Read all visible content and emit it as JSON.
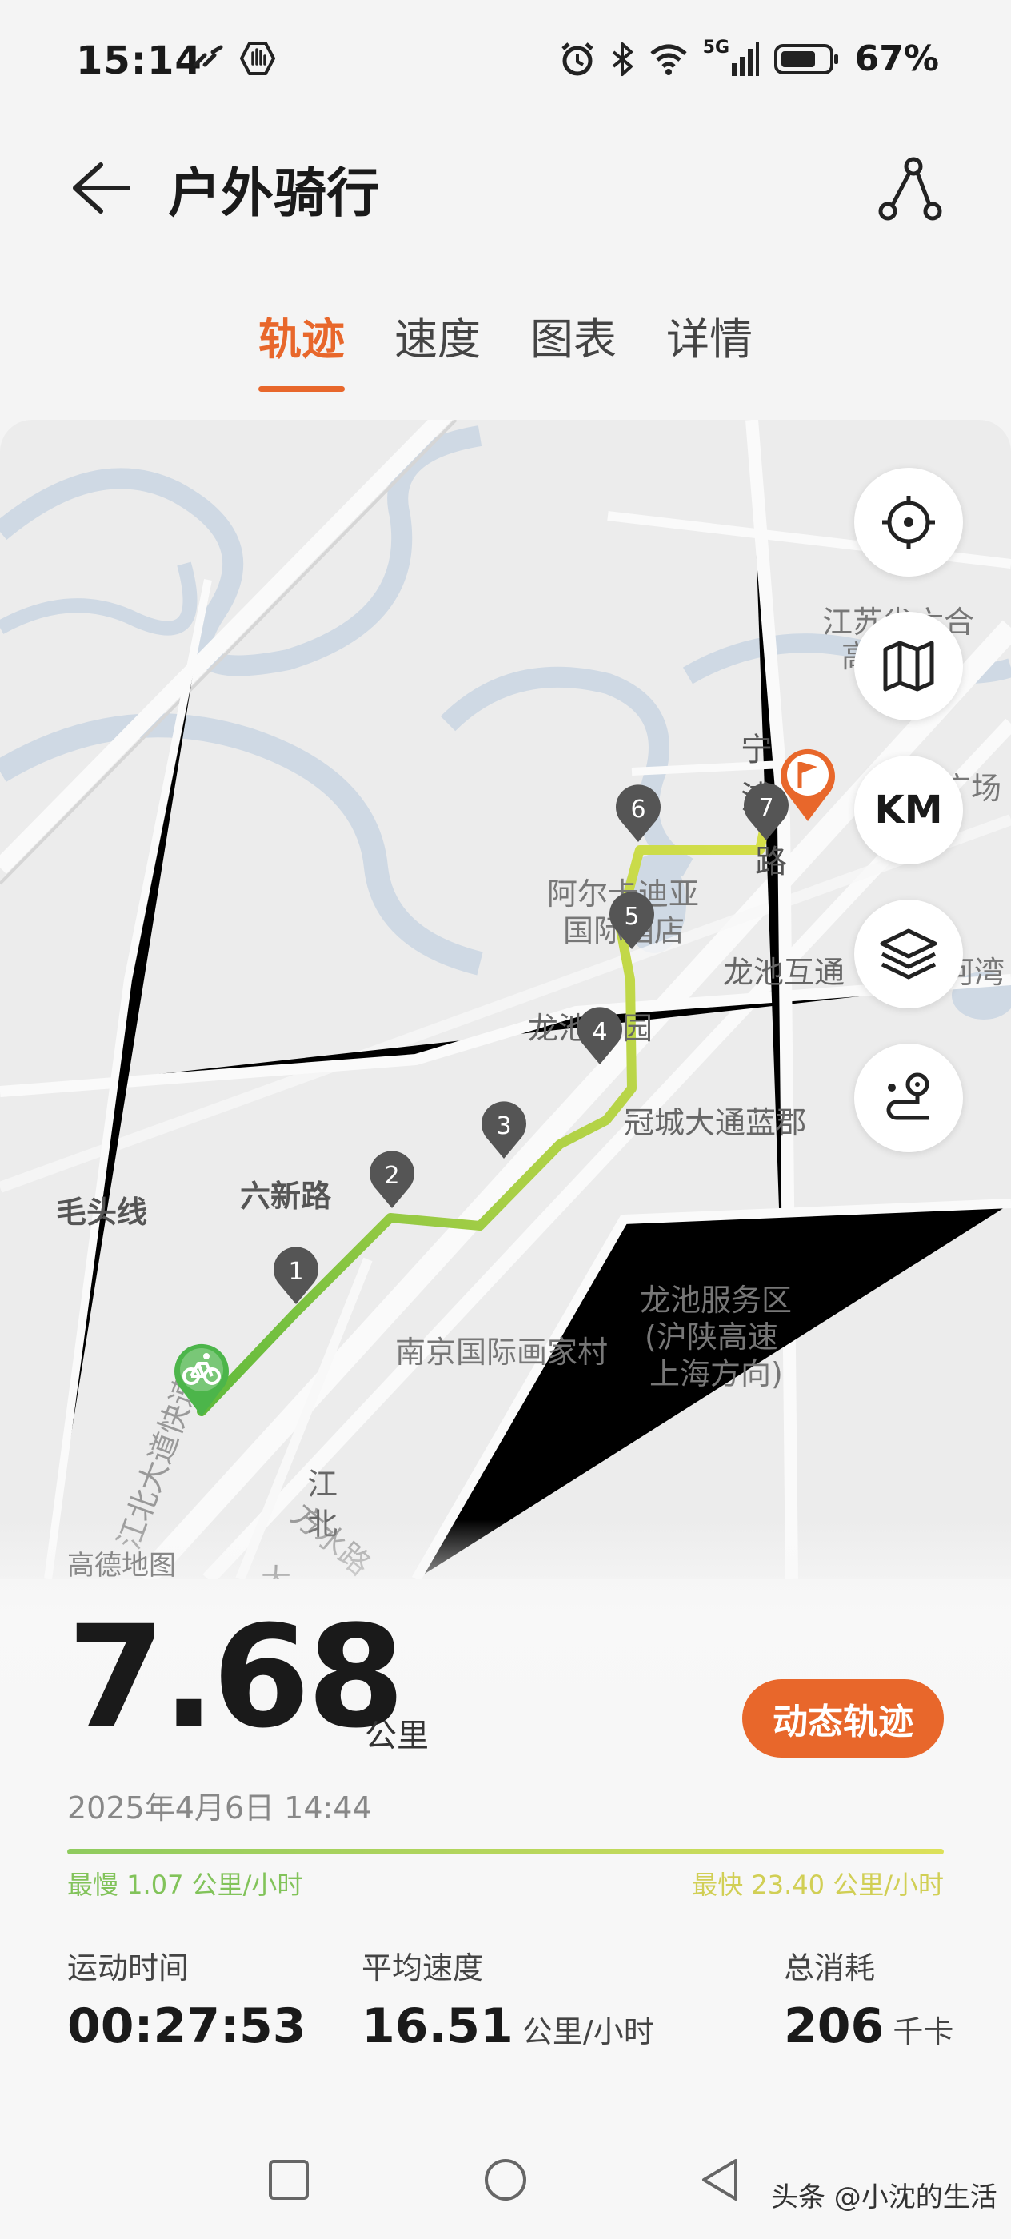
{
  "status_bar": {
    "time": "15:14",
    "battery_pct": "67%",
    "network": "5G",
    "icons": [
      "link-icon",
      "hand-icon",
      "alarm-icon",
      "bluetooth-icon",
      "wifi-icon",
      "signal-icon",
      "battery-icon"
    ]
  },
  "header": {
    "title": "户外骑行",
    "back_icon": "back-arrow-icon",
    "share_icon": "route-share-icon"
  },
  "tabs": [
    {
      "label": "轨迹",
      "active": true
    },
    {
      "label": "速度",
      "active": false
    },
    {
      "label": "图表",
      "active": false
    },
    {
      "label": "详情",
      "active": false
    }
  ],
  "map": {
    "provider": "高德地图",
    "labels": [
      "江苏省六合",
      "高",
      "宁",
      "浦",
      "路",
      "广场",
      "阿尔卡迪亚",
      "国际酒店",
      "龙池互通",
      "河湾",
      "龙池",
      "园",
      "冠城大通蓝郡",
      "毛头线",
      "六新路",
      "龙池服务区",
      "(沪陕高速",
      "上海方向)",
      "南京国际画家村",
      "江北大道快速路",
      "方水路",
      "江",
      "北",
      "大",
      "道"
    ],
    "markers": [
      "1",
      "2",
      "3",
      "4",
      "5",
      "6",
      "7"
    ],
    "buttons": {
      "locate_icon": "locate-icon",
      "map_icon": "map-icon",
      "km_label": "KM",
      "layers_icon": "layers-icon",
      "route_icon": "route-pin-icon"
    },
    "start_icon": "bicycle-icon",
    "end_icon": "flag-icon",
    "colors": {
      "route_slow": "#5fba3c",
      "route_fast": "#d8e04a",
      "accent": "#e8672b"
    }
  },
  "summary": {
    "distance": "7.68",
    "distance_unit": "公里",
    "dynamic_button": "动态轨迹",
    "datetime": "2025年4月6日 14:44",
    "slowest": "最慢 1.07 公里/小时",
    "fastest": "最快 23.40 公里/小时",
    "stats": [
      {
        "label": "运动时间",
        "value": "00:27:53",
        "unit": ""
      },
      {
        "label": "平均速度",
        "value": "16.51",
        "unit": "公里/小时"
      },
      {
        "label": "总消耗",
        "value": "206",
        "unit": "千卡"
      }
    ]
  },
  "nav_bar": {
    "icons": [
      "recent-apps-icon",
      "home-icon",
      "back-icon"
    ],
    "watermark": "头条 @小沈的生活"
  }
}
